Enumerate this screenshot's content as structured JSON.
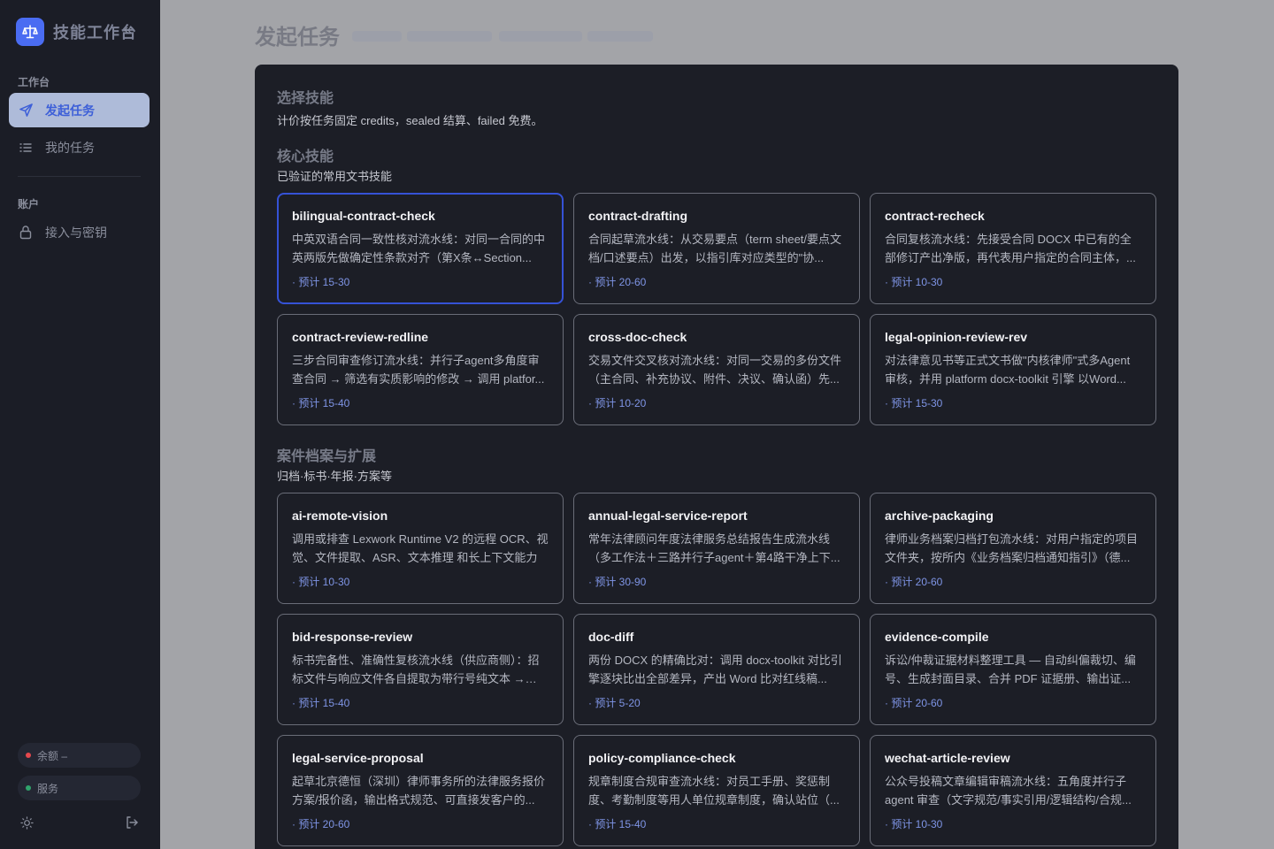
{
  "brand": {
    "name": "技能工作台",
    "collapse_icon": "«"
  },
  "sidebar": {
    "section_workbench": "工作台",
    "nav": [
      {
        "label": "发起任务",
        "icon": "send-icon"
      },
      {
        "label": "我的任务",
        "icon": "list-icon"
      }
    ],
    "section_account": "账户",
    "account_nav": [
      {
        "label": "接入与密钥",
        "icon": "lock-icon"
      }
    ],
    "balance": "余额 –",
    "service": "服务",
    "colors": {
      "balance_dot": "#e5484d",
      "service_dot": "#30a46c",
      "accent": "#4a6cf2"
    }
  },
  "page": {
    "title": "发起任务"
  },
  "panel": {
    "title": "选择技能",
    "pricing_note": "计价按任务固定 credits，sealed 结算、failed 免费。",
    "groups": [
      {
        "title": "核心技能",
        "subtitle": "已验证的常用文书技能",
        "cards": [
          {
            "name": "bilingual-contract-check",
            "desc": "中英双语合同一致性核对流水线：对同一合同的中英两版先做确定性条款对齐（第X条↔Section...",
            "est": "· 预计 15-30"
          },
          {
            "name": "contract-drafting",
            "desc": "合同起草流水线：从交易要点（term sheet/要点文档/口述要点）出发，以指引库对应类型的\"协...",
            "est": "· 预计 20-60"
          },
          {
            "name": "contract-recheck",
            "desc": "合同复核流水线：先接受合同 DOCX 中已有的全部修订产出净版，再代表用户指定的合同主体，...",
            "est": "· 预计 10-30"
          },
          {
            "name": "contract-review-redline",
            "desc": "三步合同审查修订流水线：并行子agent多角度审查合同 → 筛选有实质影响的修改 → 调用 platfor...",
            "est": "· 预计 15-40"
          },
          {
            "name": "cross-doc-check",
            "desc": "交易文件交叉核对流水线：对同一交易的多份文件（主合同、补充协议、附件、决议、确认函）先...",
            "est": "· 预计 10-20"
          },
          {
            "name": "legal-opinion-review-rev",
            "desc": "对法律意见书等正式文书做\"内核律师\"式多Agent审核，并用 platform docx-toolkit 引擎 以Word...",
            "est": "· 预计 15-30"
          }
        ]
      },
      {
        "title": "案件档案与扩展",
        "subtitle": "归档·标书·年报·方案等",
        "cards": [
          {
            "name": "ai-remote-vision",
            "desc": "调用或排查 Lexwork Runtime V2 的远程 OCR、视觉、文件提取、ASR、文本推理 和长上下文能力",
            "est": "· 预计 10-30"
          },
          {
            "name": "annual-legal-service-report",
            "desc": "常年法律顾问年度法律服务总结报告生成流水线（多工作法＋三路并行子agent＋第4路干净上下...",
            "est": "· 预计 30-90"
          },
          {
            "name": "archive-packaging",
            "desc": "律师业务档案归档打包流水线：对用户指定的项目文件夹，按所内《业务档案归档通知指引》（德...",
            "est": "· 预计 20-60"
          },
          {
            "name": "bid-response-review",
            "desc": "标书完备性、准确性复核流水线（供应商侧）：招标文件与响应文件各自提取为带行号纯文本 → 版...",
            "est": "· 预计 15-40"
          },
          {
            "name": "doc-diff",
            "desc": "两份 DOCX 的精确比对：调用 docx-toolkit 对比引擎逐块比出全部差异，产出 Word 比对红线稿...",
            "est": "· 预计 5-20"
          },
          {
            "name": "evidence-compile",
            "desc": "诉讼/仲裁证据材料整理工具 — 自动纠偏裁切、编号、生成封面目录、合并 PDF 证据册、输出证...",
            "est": "· 预计 20-60"
          },
          {
            "name": "legal-service-proposal",
            "desc": "起草北京德恒（深圳）律师事务所的法律服务报价方案/报价函，输出格式规范、可直接发客户的...",
            "est": "· 预计 20-60"
          },
          {
            "name": "policy-compliance-check",
            "desc": "规章制度合规审查流水线：对员工手册、奖惩制度、考勤制度等用人单位规章制度，确认站位（...",
            "est": "· 预计 15-40"
          },
          {
            "name": "wechat-article-review",
            "desc": "公众号投稿文章编辑审稿流水线：五角度并行子agent 审查（文字规范/事实引用/逻辑结构/合规...",
            "est": "· 预计 10-30"
          }
        ]
      }
    ]
  }
}
